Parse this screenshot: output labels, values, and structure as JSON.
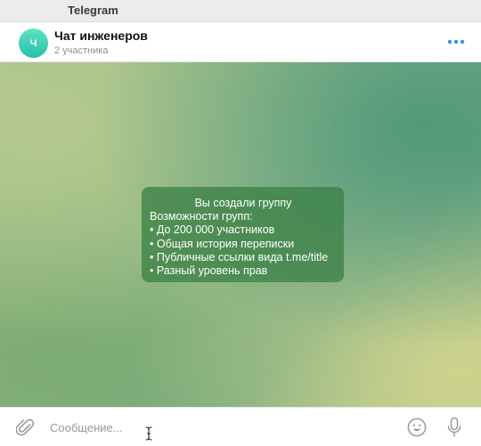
{
  "window": {
    "title": "Telegram"
  },
  "chat": {
    "avatar_letter": "Ч",
    "name": "Чат инженеров",
    "subtitle": "2 участника"
  },
  "service_message": {
    "heading": "Вы создали группу",
    "intro": "Возможности групп:",
    "items": [
      "• До 200 000 участников",
      "• Общая история переписки",
      "• Публичные ссылки вида t.me/title",
      "• Разный уровень прав"
    ]
  },
  "composer": {
    "placeholder": "Сообщение..."
  },
  "icons": {
    "more": "more-dots-icon",
    "attach": "paperclip-icon",
    "emoji": "smiley-icon",
    "mic": "microphone-icon",
    "cursor": "text-cursor-icon"
  },
  "colors": {
    "accent": "#3390ec",
    "avatar": "#2ec4a9",
    "service_bubble": "#3c8246"
  }
}
